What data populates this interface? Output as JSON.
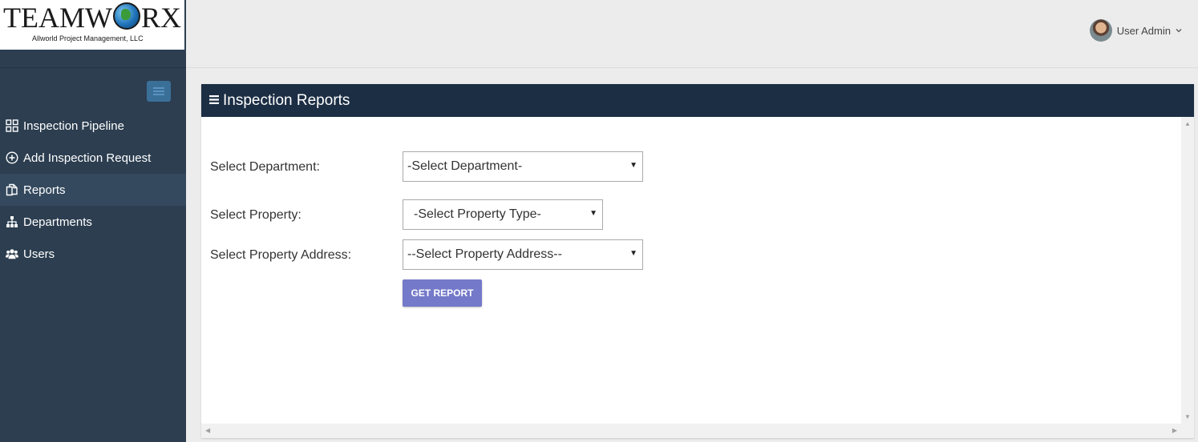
{
  "brand": {
    "name_before": "TEAMW",
    "name_after": "RX",
    "tagline": "Allworld Project Management, LLC"
  },
  "sidebar": {
    "items": [
      {
        "label": "Inspection Pipeline",
        "icon": "grid-icon"
      },
      {
        "label": "Add Inspection Request",
        "icon": "plus-circle-icon"
      },
      {
        "label": "Reports",
        "icon": "copy-document-icon",
        "active": true
      },
      {
        "label": "Departments",
        "icon": "sitemap-icon"
      },
      {
        "label": "Users",
        "icon": "users-icon"
      }
    ]
  },
  "header": {
    "user_name": "User Admin"
  },
  "panel": {
    "title": "Inspection Reports",
    "department_label": "Select Department:",
    "department_value": "-Select Department-",
    "property_label": "Select Property:",
    "property_value": "-Select Property Type-",
    "address_label": "Select Property Address:",
    "address_value": "--Select Property Address--",
    "button_label": "GET REPORT"
  },
  "colors": {
    "sidebar_bg": "#2c3e50",
    "panel_header_bg": "#1c2e44",
    "button_bg": "#7479c9"
  }
}
